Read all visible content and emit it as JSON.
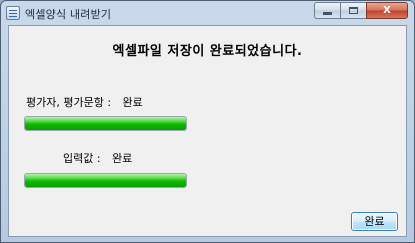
{
  "window": {
    "title": "엑셀양식 내려받기",
    "close_glyph": "X"
  },
  "dialog": {
    "heading": "엑셀파일 저장이 완료되었습니다.",
    "rows": [
      {
        "label": "평가자, 평가문항 :",
        "status": "완료",
        "progress": 1.0
      },
      {
        "label": "입력값 :",
        "status": "완료",
        "progress": 1.0
      }
    ],
    "ok_label": "완료"
  },
  "colors": {
    "progress_green": "#12b800",
    "button_border": "#3c7fb1"
  }
}
